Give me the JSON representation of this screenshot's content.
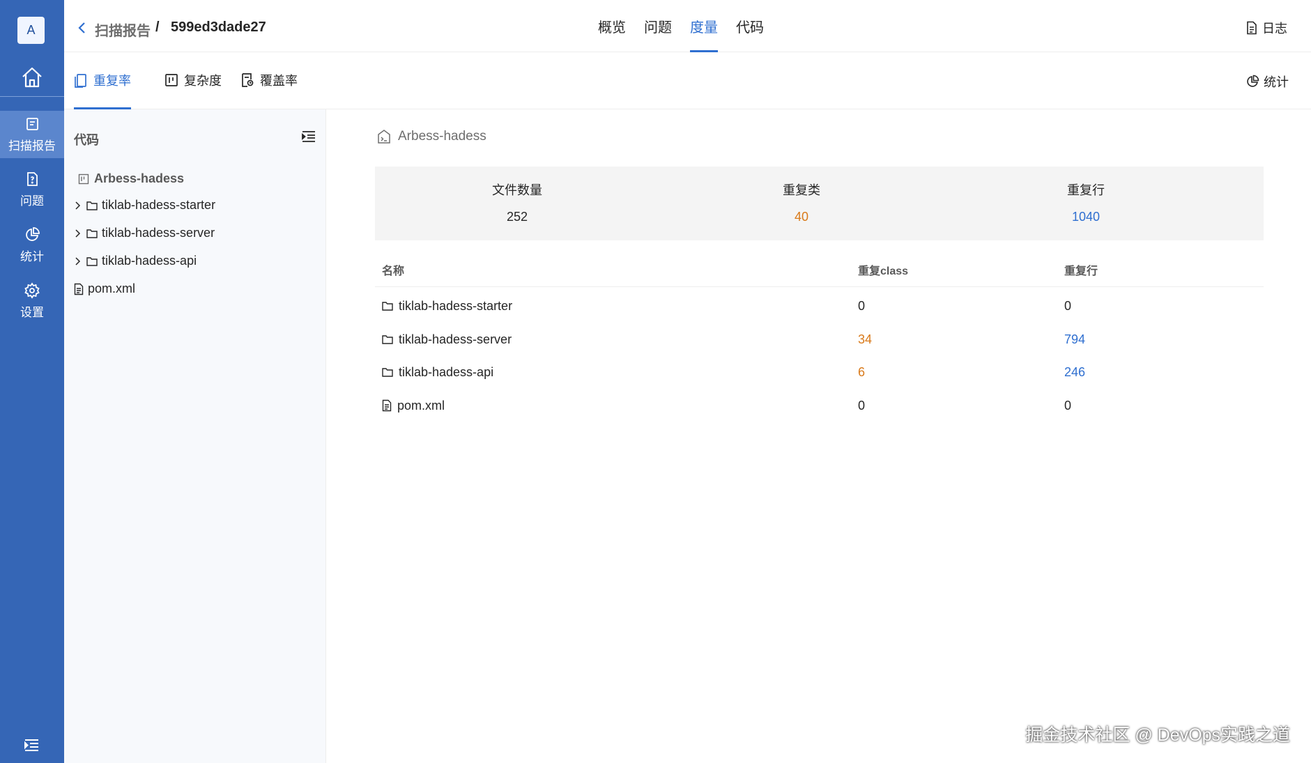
{
  "colors": {
    "accent": "#2f6fd0",
    "sidebar": "#3566b6",
    "orange": "#d97a1a",
    "blue": "#2f6fd0"
  },
  "sidebar": {
    "avatar": "A",
    "items": [
      {
        "label": "扫描报告",
        "icon": "scan-report-icon",
        "active": true
      },
      {
        "label": "问题",
        "icon": "issue-icon",
        "active": false
      },
      {
        "label": "统计",
        "icon": "chart-pie-icon",
        "active": false
      },
      {
        "label": "设置",
        "icon": "gear-icon",
        "active": false
      }
    ]
  },
  "header": {
    "breadcrumb_parent": "扫描报告",
    "breadcrumb_sep": "/",
    "breadcrumb_current": "599ed3dade27",
    "tabs": [
      {
        "label": "概览",
        "active": false
      },
      {
        "label": "问题",
        "active": false
      },
      {
        "label": "度量",
        "active": true
      },
      {
        "label": "代码",
        "active": false
      }
    ],
    "log_label": "日志"
  },
  "metric_tabs": {
    "tabs": [
      {
        "label": "重复率",
        "icon": "duplicate-icon",
        "active": true
      },
      {
        "label": "复杂度",
        "icon": "complexity-icon",
        "active": false
      },
      {
        "label": "覆盖率",
        "icon": "coverage-icon",
        "active": false
      }
    ],
    "stats_label": "统计"
  },
  "tree": {
    "title": "代码",
    "root": "Arbess-hadess",
    "nodes": [
      {
        "label": "tiklab-hadess-starter",
        "type": "folder"
      },
      {
        "label": "tiklab-hadess-server",
        "type": "folder"
      },
      {
        "label": "tiklab-hadess-api",
        "type": "folder"
      },
      {
        "label": "pom.xml",
        "type": "file"
      }
    ]
  },
  "main": {
    "repo_name": "Arbess-hadess",
    "summary": [
      {
        "label": "文件数量",
        "value": "252"
      },
      {
        "label": "重复类",
        "value": "40"
      },
      {
        "label": "重复行",
        "value": "1040"
      }
    ],
    "table": {
      "headers": [
        "名称",
        "重复class",
        "重复行"
      ],
      "rows": [
        {
          "name": "tiklab-hadess-starter",
          "type": "folder",
          "dup_class": "0",
          "dup_lines": "0"
        },
        {
          "name": "tiklab-hadess-server",
          "type": "folder",
          "dup_class": "34",
          "dup_lines": "794"
        },
        {
          "name": "tiklab-hadess-api",
          "type": "folder",
          "dup_class": "6",
          "dup_lines": "246"
        },
        {
          "name": "pom.xml",
          "type": "file",
          "dup_class": "0",
          "dup_lines": "0"
        }
      ]
    }
  },
  "watermark": "掘金技术社区 @ DevOps实践之道"
}
